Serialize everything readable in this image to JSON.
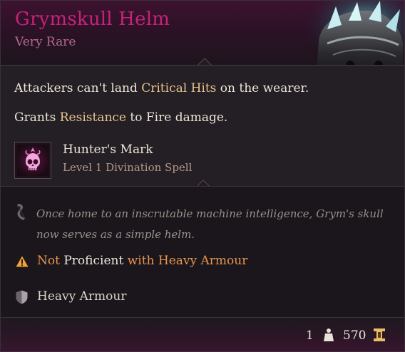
{
  "item": {
    "name": "Grymskull Helm",
    "rarity": "Very Rare",
    "rarity_color": "#c8217a"
  },
  "properties": {
    "line1": {
      "before": "Attackers can't land ",
      "highlight": "Critical Hits",
      "after": " on the wearer."
    },
    "line2": {
      "before": "Grants ",
      "highlight": "Resistance",
      "after": " to Fire damage."
    },
    "spell": {
      "name": "Hunter's Mark",
      "subtitle": "Level 1 Divination Spell",
      "icon": "skull-spell-icon"
    }
  },
  "lore": {
    "text": "Once home to an inscrutable machine intelligence, Grym's skull now serves as a simple helm.",
    "icon": "quill-icon"
  },
  "proficiency": {
    "prefix": "Not",
    "middle": " Proficient ",
    "suffix": "with Heavy Armour",
    "icon": "warning-icon",
    "warning_color": "#e8944e"
  },
  "armour": {
    "type": "Heavy Armour",
    "icon": "shield-icon"
  },
  "footer": {
    "weight": "1",
    "weight_icon": "weight-icon",
    "value": "570",
    "value_icon": "gold-icon"
  }
}
